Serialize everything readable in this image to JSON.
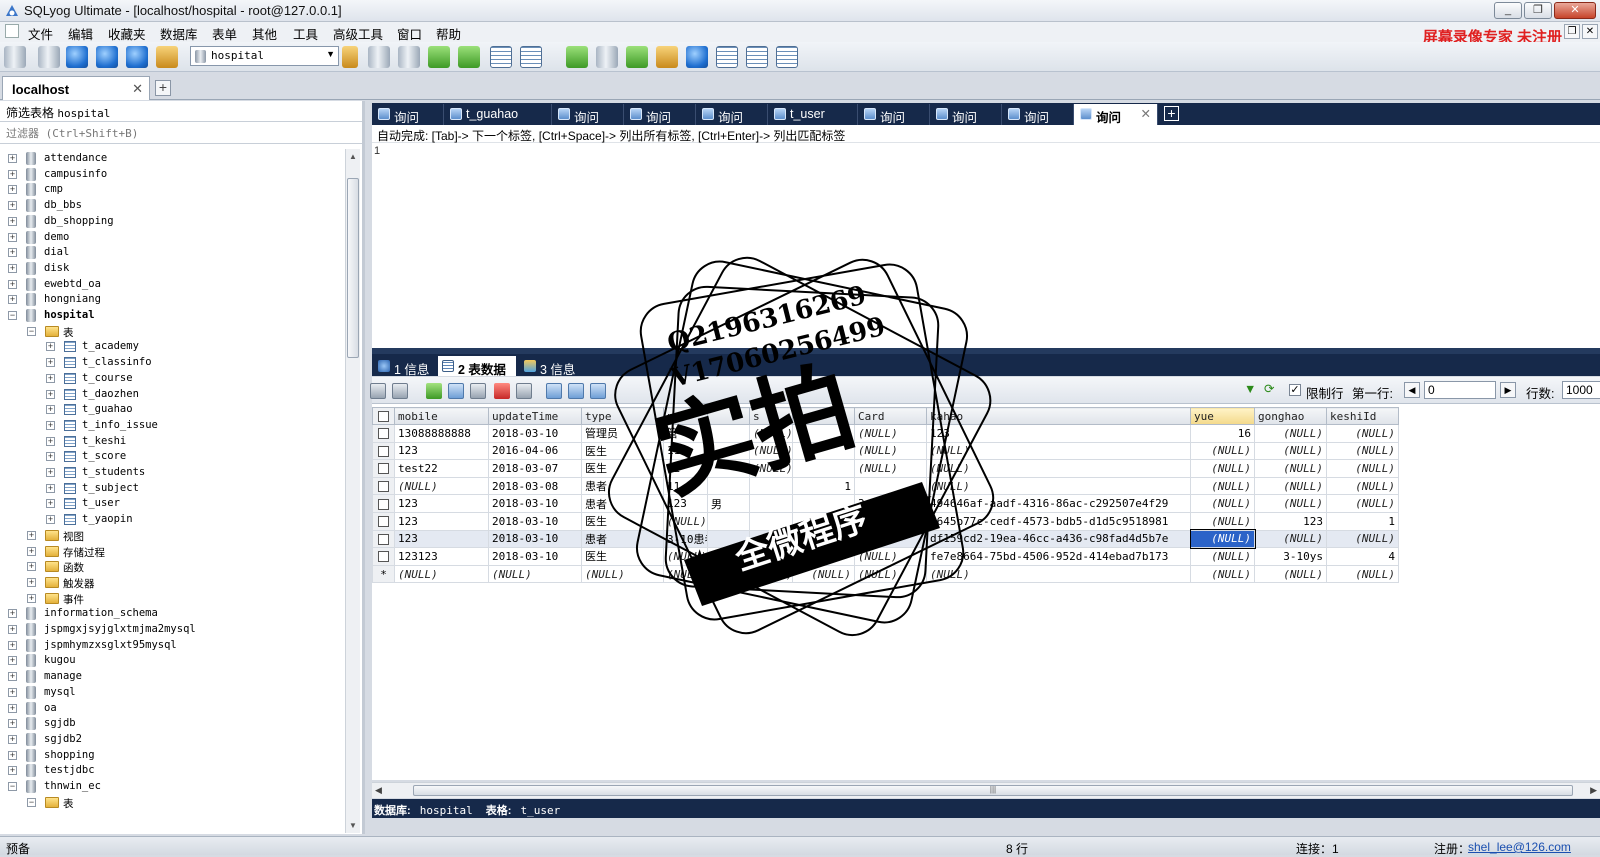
{
  "window": {
    "title": "SQLyog Ultimate - [localhost/hospital - root@127.0.0.1]",
    "minimize": "_",
    "restore": "❐",
    "close": "✕"
  },
  "menu": {
    "items": [
      "文件",
      "编辑",
      "收藏夹",
      "数据库",
      "表单",
      "其他",
      "工具",
      "高级工具",
      "窗口",
      "帮助"
    ],
    "register_notice": "屏幕录像专家  未注册"
  },
  "toolbar": {
    "database_select": "hospital"
  },
  "connection": {
    "tab": "localhost",
    "close": "✕",
    "add": "+"
  },
  "object_browser": {
    "filter_label": "筛选表格",
    "filter_value": "hospital",
    "filter_placeholder": "过滤器 (Ctrl+Shift+B)",
    "databases": [
      "attendance",
      "campusinfo",
      "cmp",
      "db_bbs",
      "db_shopping",
      "demo",
      "dial",
      "disk",
      "ewebtd_oa",
      "hongniang",
      "hospital"
    ],
    "hospital_tables_folder": "表",
    "hospital_tables": [
      "t_academy",
      "t_classinfo",
      "t_course",
      "t_daozhen",
      "t_guahao",
      "t_info_issue",
      "t_keshi",
      "t_score",
      "t_students",
      "t_subject",
      "t_user",
      "t_yaopin"
    ],
    "hospital_folders": [
      "视图",
      "存储过程",
      "函数",
      "触发器",
      "事件"
    ],
    "databases_after": [
      "information_schema",
      "jspmgxjsyjglxtmjma2mysql",
      "jspmhymzxsglxt95mysql",
      "kugou",
      "manage",
      "mysql",
      "oa",
      "sgjdb",
      "sgjdb2",
      "shopping",
      "testjdbc",
      "thnwin_ec"
    ],
    "thnwin_folder": "表"
  },
  "query_tabs": [
    "询问",
    "t_guahao",
    "询问",
    "询问",
    "询问",
    "t_user",
    "询问",
    "询问",
    "询问",
    "询问"
  ],
  "query_tab_close": "✕",
  "editor": {
    "autocomplete_hint": "自动完成: [Tab]-> 下一个标签, [Ctrl+Space]-> 列出所有标签, [Ctrl+Enter]-> 列出匹配标签",
    "line_number": "1"
  },
  "result_tabs": [
    "1 信息",
    "2 表数据",
    "3 信息"
  ],
  "grid_toolbar": {
    "limit_label": "限制行",
    "first_row_label": "第一行:",
    "first_row_value": "0",
    "rows_label": "行数:",
    "rows_value": "1000",
    "limit_checked": "✓"
  },
  "grid": {
    "columns": [
      "mobile",
      "updateTime",
      "type",
      "n",
      "s",
      "age",
      "Card",
      "kahao",
      "yue",
      "gonghao",
      "keshiId"
    ],
    "rows": [
      [
        "13088888888",
        "2018-03-10",
        "管理员",
        "管",
        "",
        "(NULL)",
        "",
        "(NULL)",
        "123",
        "16",
        "(NULL)",
        "(NULL)"
      ],
      [
        "123",
        "2016-04-06",
        "医生",
        "11",
        "",
        "(NULL)",
        "",
        "(NULL)",
        "(NULL)",
        "(NULL)",
        "(NULL)",
        "(NULL)"
      ],
      [
        "test22",
        "2018-03-07",
        "医生",
        "12",
        "",
        "(NULL)",
        "",
        "(NULL)",
        "(NULL)",
        "(NULL)",
        "(NULL)",
        "(NULL)"
      ],
      [
        "(NULL)",
        "2018-03-08",
        "患者",
        "11",
        "",
        "",
        "1",
        "",
        "(NULL)",
        "(NULL)",
        "(NULL)",
        "(NULL)"
      ],
      [
        "123",
        "2018-03-10",
        "患者",
        "123",
        "男",
        "",
        "",
        "3",
        "494646af-aadf-4316-86ac-c292507e4f29",
        "(NULL)",
        "(NULL)",
        "(NULL)"
      ],
      [
        "123",
        "2018-03-10",
        "医生",
        "(NULL)",
        "",
        "",
        "",
        "",
        "2645b77c-cedf-4573-bdb5-d1d5c9518981",
        "(NULL)",
        "123",
        "1"
      ],
      [
        "123",
        "2018-03-10",
        "患者",
        "3-10患者",
        "",
        "",
        "",
        "123123",
        "df159cd2-19ea-46cc-a436-c98fad4d5b7e",
        "(NULL)",
        "(NULL)",
        "(NULL)"
      ],
      [
        "123123",
        "2018-03-10",
        "医生",
        "(NULL)",
        "",
        "(NULL)",
        "",
        "(NULL)",
        "fe7e8664-75bd-4506-952d-414ebad7b173",
        "(NULL)",
        "3-10ys",
        "4"
      ],
      [
        "(NULL)",
        "(NULL)",
        "(NULL)",
        "(NULL)",
        "",
        "(NULL)",
        "(NULL)",
        "(NULL)",
        "(NULL)",
        "(NULL)",
        "(NULL)",
        "(NULL)"
      ]
    ],
    "new_row_marker": "*"
  },
  "info_bar": {
    "db_label": "数据库:",
    "db_value": "hospital",
    "table_label": "表格:",
    "table_value": "t_user"
  },
  "status": {
    "ready": "预备",
    "rows": "8 行",
    "connections": "连接：1",
    "register": "注册：",
    "email": "shel_lee@126.com"
  },
  "watermark": {
    "qq": "Q2196316269",
    "vx": "V17060256499",
    "big_text": "实拍",
    "banner_text": "全微程序"
  }
}
